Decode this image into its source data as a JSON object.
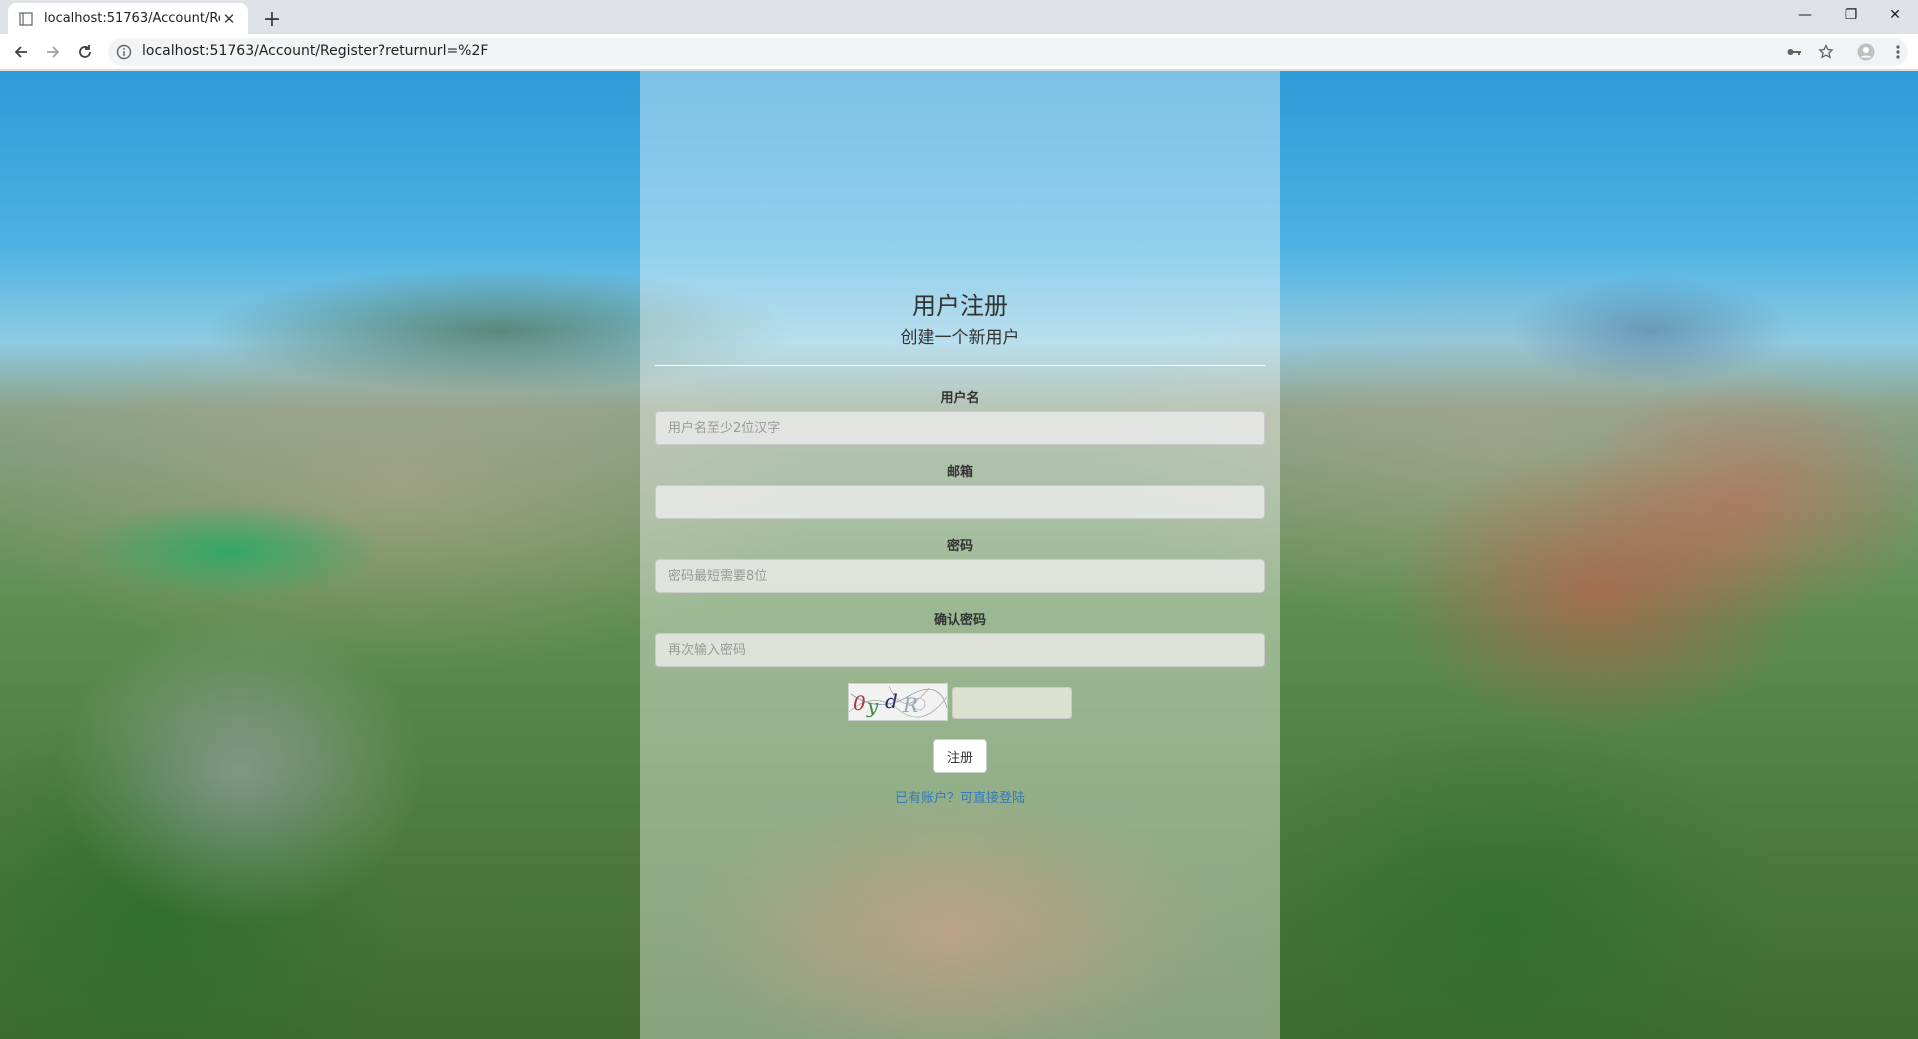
{
  "browser": {
    "tab_title": "localhost:51763/Account/Regi",
    "tab_close": "✕",
    "new_tab": "+",
    "url": "localhost:51763/Account/Register?returnurl=%2F",
    "window_controls": {
      "minimize": "—",
      "restore": "❐",
      "close": "✕"
    }
  },
  "form": {
    "title": "用户注册",
    "subtitle": "创建一个新用户",
    "fields": [
      {
        "label": "用户名",
        "placeholder": "用户名至少2位汉字",
        "value": ""
      },
      {
        "label": "邮箱",
        "placeholder": "",
        "value": ""
      },
      {
        "label": "密码",
        "placeholder": "密码最短需要8位",
        "value": ""
      },
      {
        "label": "确认密码",
        "placeholder": "再次输入密码",
        "value": ""
      }
    ],
    "captcha": {
      "code": "0ydR",
      "input_value": ""
    },
    "submit_label": "注册",
    "login_link": "已有账户？可直接登陆"
  },
  "colors": {
    "link": "#337ab7",
    "panel": "rgba(255,255,255,0.38)"
  },
  "icons": [
    "page-favicon-icon",
    "back-arrow-icon",
    "forward-arrow-icon",
    "reload-icon",
    "info-icon",
    "key-icon",
    "star-icon",
    "profile-icon",
    "menu-dots-icon"
  ]
}
